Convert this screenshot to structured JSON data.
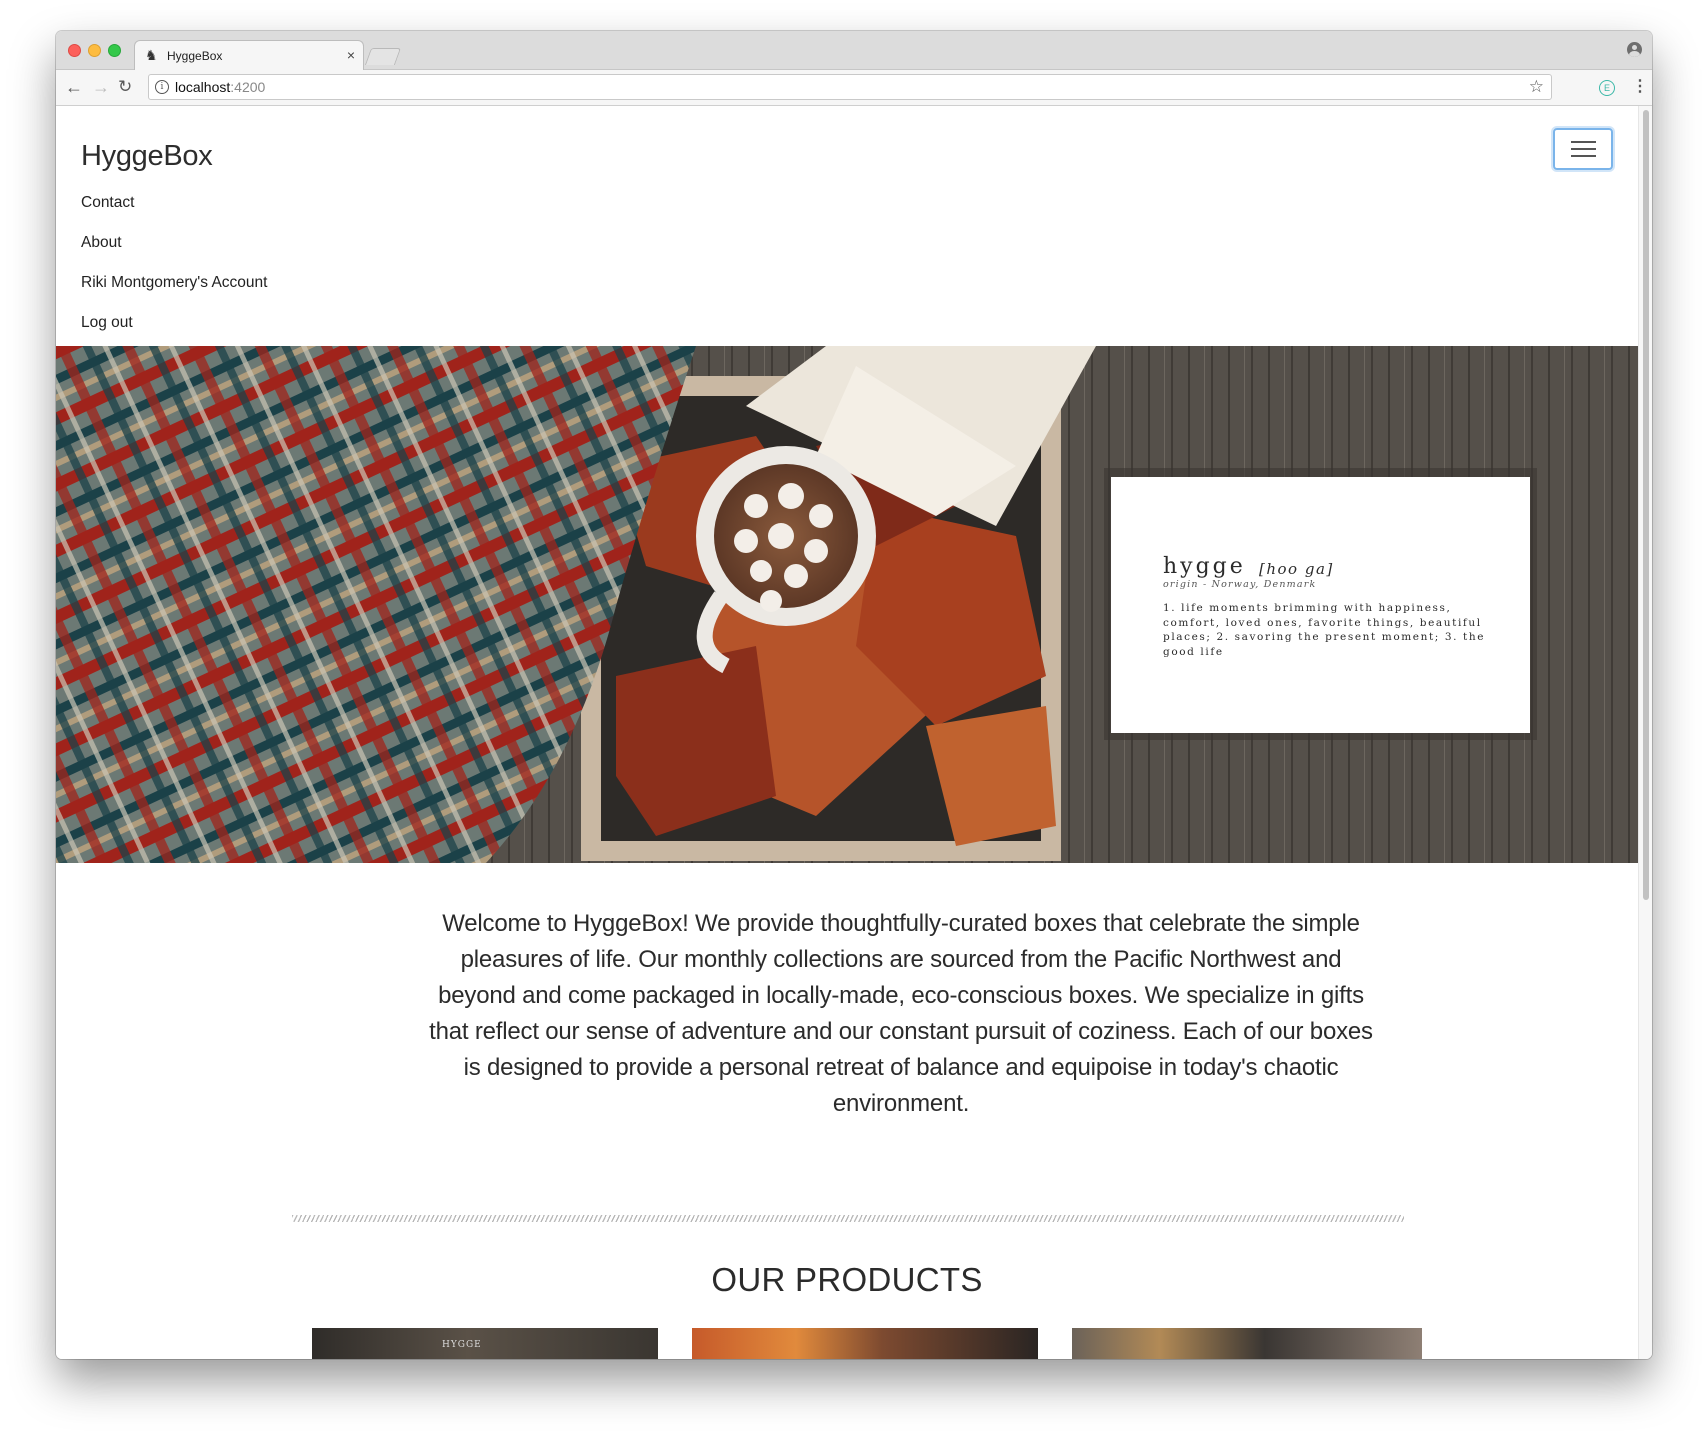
{
  "browser": {
    "tab_title": "HyggeBox",
    "tab_close": "×",
    "url_host": "localhost",
    "url_port": ":4200",
    "icons": [
      "favicon-icon",
      "close-icon",
      "back-arrow-icon",
      "forward-arrow-icon",
      "reload-icon",
      "info-icon",
      "star-icon",
      "extension-icon",
      "menu-dots-icon",
      "profile-icon"
    ]
  },
  "nav": {
    "brand": "HyggeBox",
    "links": [
      "Contact",
      "About",
      "Riki Montgomery's Account",
      "Log out"
    ],
    "toggle_icon": "hamburger-menu-icon"
  },
  "hero": {
    "definition": {
      "word": "hygge",
      "pronunciation": "[hoo ga]",
      "origin": "origin - Norway, Denmark",
      "text": "1. life moments brimming with happiness, comfort, loved ones, favorite things, beautiful places; 2. savoring the present moment; 3. the good life"
    }
  },
  "main": {
    "welcome": "Welcome to HyggeBox! We provide thoughtfully-curated boxes that celebrate the simple pleasures of life. Our monthly collections are sourced from the Pacific Northwest and beyond and come packaged in locally-made, eco-conscious boxes. We specialize in gifts that reflect our sense of adventure and our constant pursuit of coziness. Each of our boxes is designed to provide a personal retreat of balance and equipoise in today's chaotic environment.",
    "products_heading": "OUR PRODUCTS",
    "product_images": [
      {
        "label": "HYGGE"
      },
      {
        "label": ""
      },
      {
        "label": ""
      }
    ]
  },
  "colors": {
    "focus_ring": "#7ab4ea",
    "text": "#2b2b2b",
    "traffic_red": "#fc605b",
    "traffic_yellow": "#fdbc40",
    "traffic_green": "#34c84a"
  }
}
